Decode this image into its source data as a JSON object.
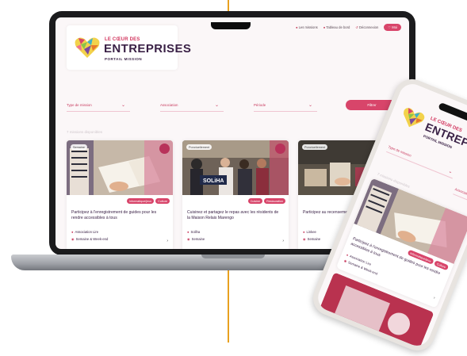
{
  "colors": {
    "accent": "#d8456a",
    "brand_dark": "#3a2146",
    "line": "#e9a11f"
  },
  "site": {
    "topbar": {
      "links": [
        {
          "icon": "user-icon",
          "label": "Les missions"
        },
        {
          "icon": "dashboard-icon",
          "label": "Tableau de bord"
        },
        {
          "icon": "logout-icon",
          "label": "Déconnexion"
        }
      ],
      "fav_label": "Moi"
    },
    "logo": {
      "small": "LE CŒUR DES",
      "big": "ENTREPRISES",
      "tagline": "PORTAIL MISSION"
    },
    "filters": {
      "mission_type": "Type de mission",
      "association": "Association",
      "period": "Période",
      "submit": "Filtrer"
    },
    "missions_count": "7 missions disponibles",
    "cards": [
      {
        "pill": "Semaine",
        "badge": "",
        "tags": [
          "Informatique/jeux",
          "Culture"
        ],
        "title": "Participez à l'enregistrement de guides pour les rendre accessibles à tous",
        "org": "Association Lire",
        "schedule": "Semaine & Week-end"
      },
      {
        "pill": "Ponctuellement",
        "badge": "",
        "tags": [
          "Cuisine",
          "Restauration"
        ],
        "title": "Cuisinez et partagez le repas avec les résidents de la Maison Relais Marengo",
        "org": "Soliha",
        "schedule": "Semaine"
      },
      {
        "pill": "Ponctuellement",
        "badge": "",
        "tags": [
          "Culture"
        ],
        "title": "Participez au recensement des denrées alimentaires",
        "org": "Linkee",
        "schedule": "Semaine"
      }
    ]
  },
  "phone": {
    "logo": {
      "small": "LE CŒUR DES",
      "big": "ENTREPRISES",
      "tagline": "PORTAIL MISSION"
    },
    "filters": {
      "mission_type": "Type de mission",
      "association": "Association"
    },
    "missions_count": "7 missions disponibles",
    "card": {
      "tags": [
        "Informatique/jeux",
        "Culture"
      ],
      "title": "Participez à l'enregistrement de guides pour les rendre accessibles à tous",
      "org": "Association Lire",
      "schedule": "Semaine & Week-end"
    }
  }
}
